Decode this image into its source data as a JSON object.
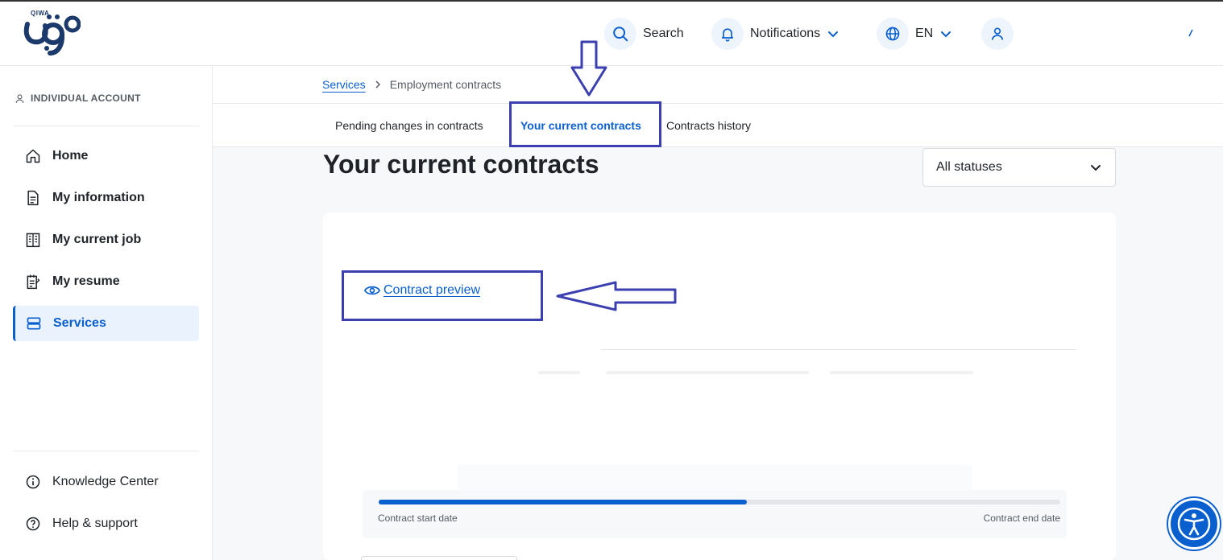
{
  "brand": {
    "small_text": "QIWA",
    "primary_color": "#0a5fcf",
    "navy": "#1b3a6b"
  },
  "header": {
    "search_label": "Search",
    "search_icon": "search-icon",
    "notifications_label": "Notifications",
    "notifications_icon": "bell-icon",
    "language_label": "EN",
    "language_icon": "globe-icon",
    "profile_icon": "user-icon"
  },
  "sidebar": {
    "account_label": "INDIVIDUAL ACCOUNT",
    "items": [
      {
        "label": "Home",
        "icon": "home-icon",
        "active": false
      },
      {
        "label": "My information",
        "icon": "document-icon",
        "active": false
      },
      {
        "label": "My current job",
        "icon": "building-icon",
        "active": false
      },
      {
        "label": "My resume",
        "icon": "resume-icon",
        "active": false
      },
      {
        "label": "Services",
        "icon": "services-icon",
        "active": true
      }
    ],
    "footer_items": [
      {
        "label": "Knowledge Center",
        "icon": "info-icon"
      },
      {
        "label": "Help & support",
        "icon": "help-icon"
      }
    ]
  },
  "breadcrumb": {
    "root": "Services",
    "current": "Employment contracts"
  },
  "tabs": [
    {
      "label": "Pending changes in contracts",
      "active": false
    },
    {
      "label": "Your current contracts",
      "active": true
    },
    {
      "label": "Contracts history",
      "active": false
    }
  ],
  "main": {
    "title": "Your current contracts",
    "status_filter": "All statuses",
    "contract_preview_label": "Contract preview",
    "progress": {
      "fraction": 0.54,
      "start_label": "Contract start date",
      "end_label": "Contract end date"
    }
  },
  "annotation_color": "#3b3fb0"
}
